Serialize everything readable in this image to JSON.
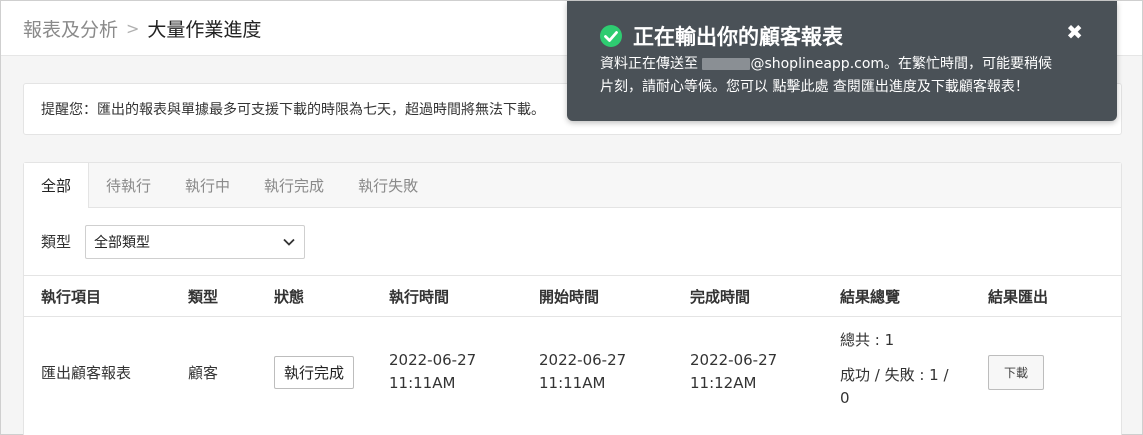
{
  "breadcrumb": {
    "parent": "報表及分析",
    "separator": ">",
    "current": "大量作業進度"
  },
  "notice": {
    "text": "提醒您：匯出的報表與單據最多可支援下載的時限為七天，超過時間將無法下載。"
  },
  "tabs": [
    {
      "label": "全部",
      "active": true
    },
    {
      "label": "待執行",
      "active": false
    },
    {
      "label": "執行中",
      "active": false
    },
    {
      "label": "執行完成",
      "active": false
    },
    {
      "label": "執行失敗",
      "active": false
    }
  ],
  "filter": {
    "label": "類型",
    "selected": "全部類型"
  },
  "table": {
    "headers": [
      "執行項目",
      "類型",
      "狀態",
      "執行時間",
      "開始時間",
      "完成時間",
      "結果總覽",
      "結果匯出"
    ],
    "rows": [
      {
        "item": "匯出顧客報表",
        "type": "顧客",
        "status": "執行完成",
        "exec_date": "2022-06-27",
        "exec_time": "11:11AM",
        "start_date": "2022-06-27",
        "start_time": "11:11AM",
        "finish_date": "2022-06-27",
        "finish_time": "11:12AM",
        "summary_total": "總共 : 1",
        "summary_result_1": "成功 / 失敗 : 1 /",
        "summary_result_2": "0",
        "download": "下載"
      }
    ]
  },
  "toast": {
    "title": "正在輸出你的顧客報表",
    "line1_before": "資料正在傳送至 ",
    "line1_after": "@shoplineapp.com。在繁忙時間，可能要稍候",
    "line2": "片刻，請耐心等候。您可以 點擊此處 查閱匯出進度及下載顧客報表！",
    "close": "✖",
    "success_color": "#2ecc71"
  }
}
